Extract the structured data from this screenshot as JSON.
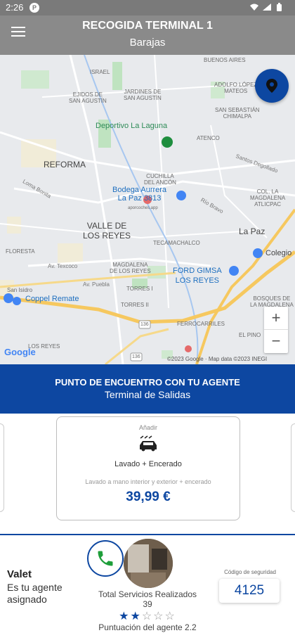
{
  "status_bar": {
    "time": "2:26",
    "notification_glyph": "P",
    "icons": "wifi-icon signal-icon battery-icon"
  },
  "header": {
    "title": "RECOGIDA TERMINAL 1",
    "subtitle": "Barajas"
  },
  "map": {
    "labels": {
      "israel": "ISRAEL",
      "buenos_aires": "BUENOS AIRES",
      "adolfo_lopez_mateos": "ADOLFO LÓPEZ\nMATEOS",
      "ejidos_san_agustin": "EJIDOS DE\nSAN AGUSTÍN",
      "jardines_san_agustin": "JARDINES DE\nSAN AGUSTÍN",
      "san_sebastian_chimalpa": "SAN SEBASTIÁN\nCHIMALPA",
      "deportivo": "Deportivo La Laguna",
      "atenco": "ATENCO",
      "santos_degollado": "Santos Degollado",
      "reforma": "REFORMA",
      "cuchilla": "CUCHILLA\nDEL ANCÓN",
      "bodega": "Bodega Aurrera\nLa Paz 3813",
      "aporcoches": "aporcoches.app",
      "rio_bravo": "Río Bravo",
      "col_magdalena": "COL. LA\nMAGDALENA\nATLICPAC",
      "valle_reyes": "VALLE DE\nLOS REYES",
      "la_paz": "La Paz",
      "tecamachalco": "TECAMACHALCO",
      "colegio": "Colegio",
      "florestal": "FLORESTA",
      "av_texcoco": "Av. Texcoco",
      "magdalena_reyes": "MAGDALENA\nDE LOS REYES",
      "ford": "FORD GIMSA\nLOS REYES",
      "san_isidro": "San Isidro",
      "coppel": "Coppel Remate",
      "torres_i": "TORRES I",
      "torres_ii": "TORRES II",
      "bosques": "BOSQUES DE\nLA MAGDALENA",
      "los_reyes": "LOS REYES",
      "ferrocarriles": "FERROCARRILES",
      "el_pino": "EL PINO",
      "av_puebla": "Av. Puebla",
      "lomas": "Loma Bonita",
      "highway_136": "136",
      "highway_136b": "136",
      "attribution": "©2023 Google · Map data ©2023 INEGI",
      "google": "Google"
    },
    "zoom_in": "+",
    "zoom_out": "−"
  },
  "banner": {
    "line1": "PUNTO DE ENCUENTRO CON TU AGENTE",
    "line2": "Terminal de Salidas"
  },
  "service": {
    "add_label": "Añadir",
    "name": "Lavado + Encerado",
    "description": "Lavado a mano interior y exterior + encerado",
    "price": "39,99 €"
  },
  "agent": {
    "title": "Valet",
    "description": "Es tu agente asignado",
    "services_label": "Total Servicios Realizados",
    "services_count": "39",
    "rating": 2,
    "rating_max": 5,
    "rating_label": "Puntuación del agente 2.2",
    "code_label": "Código de seguridad",
    "code": "4125"
  },
  "colors": {
    "primary": "#0d47a1",
    "header": "#8a8a8a",
    "map_bg": "#e8eaed",
    "road_yellow": "#f6c85f"
  }
}
